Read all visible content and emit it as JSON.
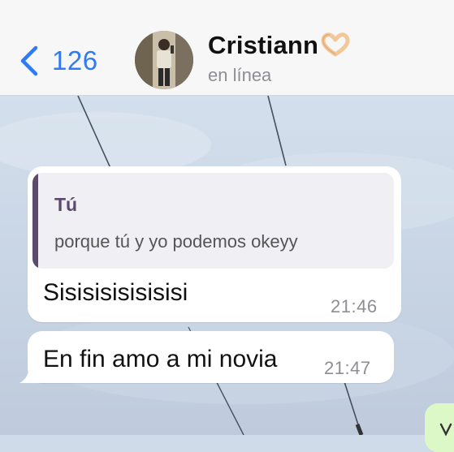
{
  "header": {
    "back_count": "126",
    "contact_name": "Cristiann",
    "contact_status": "en línea"
  },
  "messages": [
    {
      "quote_author": "Tú",
      "quote_text": "porque tú y yo podemos okeyy",
      "text": "Sisisisisisisisi",
      "time": "21:46"
    },
    {
      "text": "En fin amo a mi novia",
      "time": "21:47"
    }
  ],
  "colors": {
    "accent": "#2f7bf6",
    "quote_bar": "#5c4a6b",
    "incoming_bubble": "#ffffff",
    "outgoing_bubble": "#dcf8c6"
  }
}
